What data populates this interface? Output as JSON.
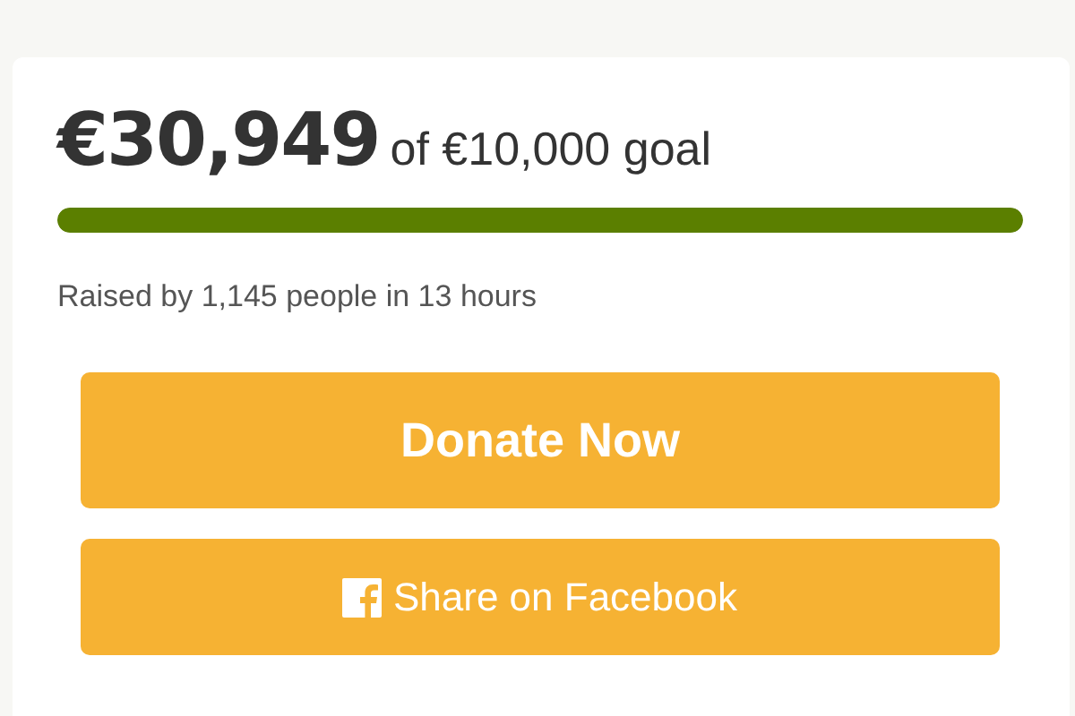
{
  "campaign": {
    "raised": "€30,949",
    "goal": "of €10,000 goal",
    "progress": {
      "level": 1
    },
    "summary": "Raised by 1,145 people in 13 hours"
  },
  "buttons": [
    {
      "kind": "primary",
      "label": "Donate Now"
    },
    {
      "kind": "facebook",
      "label": "Share on Facebook"
    }
  ]
}
